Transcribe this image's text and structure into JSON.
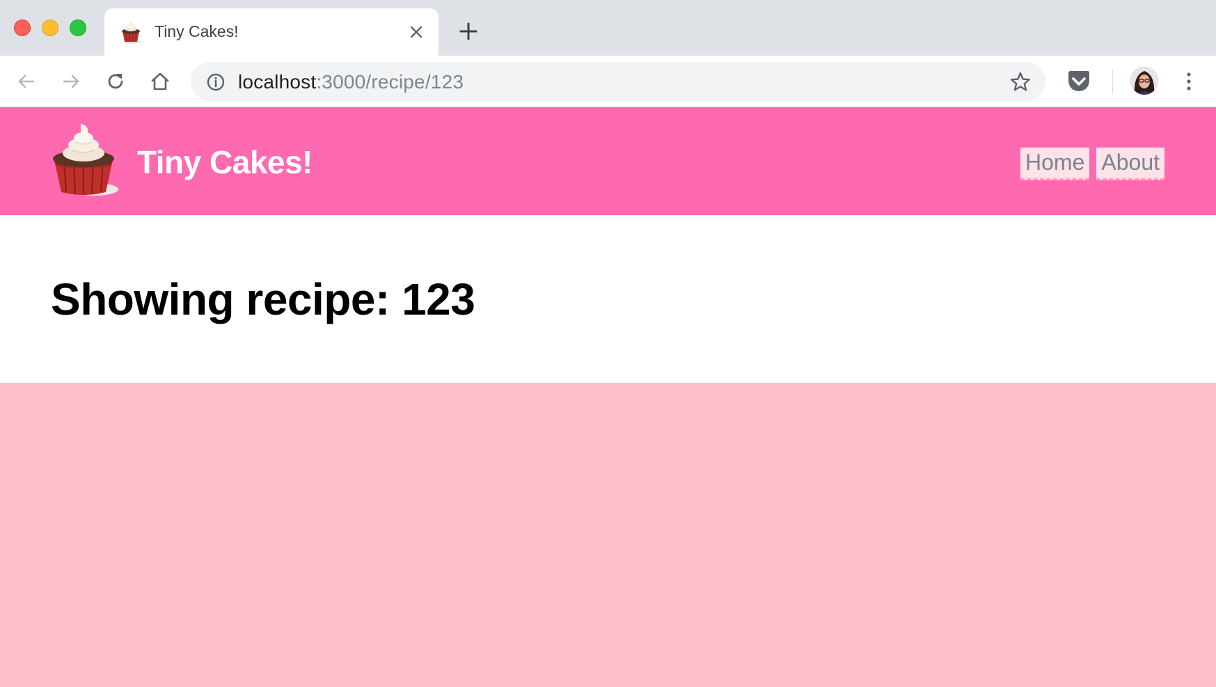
{
  "browser": {
    "tab": {
      "title": "Tiny Cakes!"
    },
    "address_bar": {
      "host": "localhost",
      "rest": ":3000/recipe/123"
    }
  },
  "site": {
    "brand": "Tiny Cakes!",
    "nav": {
      "home": "Home",
      "about": "About"
    },
    "colors": {
      "header": "#ff69b0",
      "background": "#fdbdca",
      "nav_link_bg": "#fde2e8"
    }
  },
  "main": {
    "heading": "Showing recipe: 123"
  }
}
